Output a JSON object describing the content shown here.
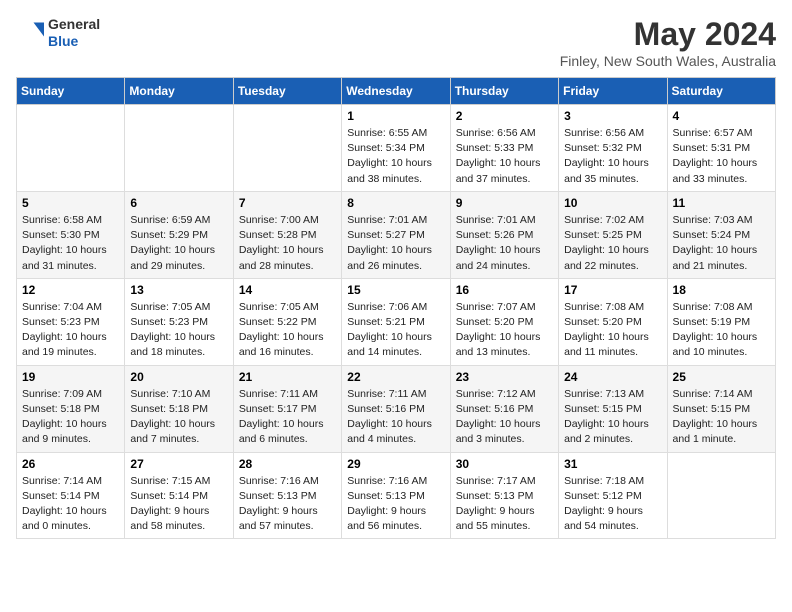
{
  "header": {
    "logo": {
      "general": "General",
      "blue": "Blue"
    },
    "title": "May 2024",
    "location": "Finley, New South Wales, Australia"
  },
  "days_of_week": [
    "Sunday",
    "Monday",
    "Tuesday",
    "Wednesday",
    "Thursday",
    "Friday",
    "Saturday"
  ],
  "weeks": [
    [
      {
        "day": "",
        "info": ""
      },
      {
        "day": "",
        "info": ""
      },
      {
        "day": "",
        "info": ""
      },
      {
        "day": "1",
        "info": "Sunrise: 6:55 AM\nSunset: 5:34 PM\nDaylight: 10 hours\nand 38 minutes."
      },
      {
        "day": "2",
        "info": "Sunrise: 6:56 AM\nSunset: 5:33 PM\nDaylight: 10 hours\nand 37 minutes."
      },
      {
        "day": "3",
        "info": "Sunrise: 6:56 AM\nSunset: 5:32 PM\nDaylight: 10 hours\nand 35 minutes."
      },
      {
        "day": "4",
        "info": "Sunrise: 6:57 AM\nSunset: 5:31 PM\nDaylight: 10 hours\nand 33 minutes."
      }
    ],
    [
      {
        "day": "5",
        "info": "Sunrise: 6:58 AM\nSunset: 5:30 PM\nDaylight: 10 hours\nand 31 minutes."
      },
      {
        "day": "6",
        "info": "Sunrise: 6:59 AM\nSunset: 5:29 PM\nDaylight: 10 hours\nand 29 minutes."
      },
      {
        "day": "7",
        "info": "Sunrise: 7:00 AM\nSunset: 5:28 PM\nDaylight: 10 hours\nand 28 minutes."
      },
      {
        "day": "8",
        "info": "Sunrise: 7:01 AM\nSunset: 5:27 PM\nDaylight: 10 hours\nand 26 minutes."
      },
      {
        "day": "9",
        "info": "Sunrise: 7:01 AM\nSunset: 5:26 PM\nDaylight: 10 hours\nand 24 minutes."
      },
      {
        "day": "10",
        "info": "Sunrise: 7:02 AM\nSunset: 5:25 PM\nDaylight: 10 hours\nand 22 minutes."
      },
      {
        "day": "11",
        "info": "Sunrise: 7:03 AM\nSunset: 5:24 PM\nDaylight: 10 hours\nand 21 minutes."
      }
    ],
    [
      {
        "day": "12",
        "info": "Sunrise: 7:04 AM\nSunset: 5:23 PM\nDaylight: 10 hours\nand 19 minutes."
      },
      {
        "day": "13",
        "info": "Sunrise: 7:05 AM\nSunset: 5:23 PM\nDaylight: 10 hours\nand 18 minutes."
      },
      {
        "day": "14",
        "info": "Sunrise: 7:05 AM\nSunset: 5:22 PM\nDaylight: 10 hours\nand 16 minutes."
      },
      {
        "day": "15",
        "info": "Sunrise: 7:06 AM\nSunset: 5:21 PM\nDaylight: 10 hours\nand 14 minutes."
      },
      {
        "day": "16",
        "info": "Sunrise: 7:07 AM\nSunset: 5:20 PM\nDaylight: 10 hours\nand 13 minutes."
      },
      {
        "day": "17",
        "info": "Sunrise: 7:08 AM\nSunset: 5:20 PM\nDaylight: 10 hours\nand 11 minutes."
      },
      {
        "day": "18",
        "info": "Sunrise: 7:08 AM\nSunset: 5:19 PM\nDaylight: 10 hours\nand 10 minutes."
      }
    ],
    [
      {
        "day": "19",
        "info": "Sunrise: 7:09 AM\nSunset: 5:18 PM\nDaylight: 10 hours\nand 9 minutes."
      },
      {
        "day": "20",
        "info": "Sunrise: 7:10 AM\nSunset: 5:18 PM\nDaylight: 10 hours\nand 7 minutes."
      },
      {
        "day": "21",
        "info": "Sunrise: 7:11 AM\nSunset: 5:17 PM\nDaylight: 10 hours\nand 6 minutes."
      },
      {
        "day": "22",
        "info": "Sunrise: 7:11 AM\nSunset: 5:16 PM\nDaylight: 10 hours\nand 4 minutes."
      },
      {
        "day": "23",
        "info": "Sunrise: 7:12 AM\nSunset: 5:16 PM\nDaylight: 10 hours\nand 3 minutes."
      },
      {
        "day": "24",
        "info": "Sunrise: 7:13 AM\nSunset: 5:15 PM\nDaylight: 10 hours\nand 2 minutes."
      },
      {
        "day": "25",
        "info": "Sunrise: 7:14 AM\nSunset: 5:15 PM\nDaylight: 10 hours\nand 1 minute."
      }
    ],
    [
      {
        "day": "26",
        "info": "Sunrise: 7:14 AM\nSunset: 5:14 PM\nDaylight: 10 hours\nand 0 minutes."
      },
      {
        "day": "27",
        "info": "Sunrise: 7:15 AM\nSunset: 5:14 PM\nDaylight: 9 hours\nand 58 minutes."
      },
      {
        "day": "28",
        "info": "Sunrise: 7:16 AM\nSunset: 5:13 PM\nDaylight: 9 hours\nand 57 minutes."
      },
      {
        "day": "29",
        "info": "Sunrise: 7:16 AM\nSunset: 5:13 PM\nDaylight: 9 hours\nand 56 minutes."
      },
      {
        "day": "30",
        "info": "Sunrise: 7:17 AM\nSunset: 5:13 PM\nDaylight: 9 hours\nand 55 minutes."
      },
      {
        "day": "31",
        "info": "Sunrise: 7:18 AM\nSunset: 5:12 PM\nDaylight: 9 hours\nand 54 minutes."
      },
      {
        "day": "",
        "info": ""
      }
    ]
  ]
}
